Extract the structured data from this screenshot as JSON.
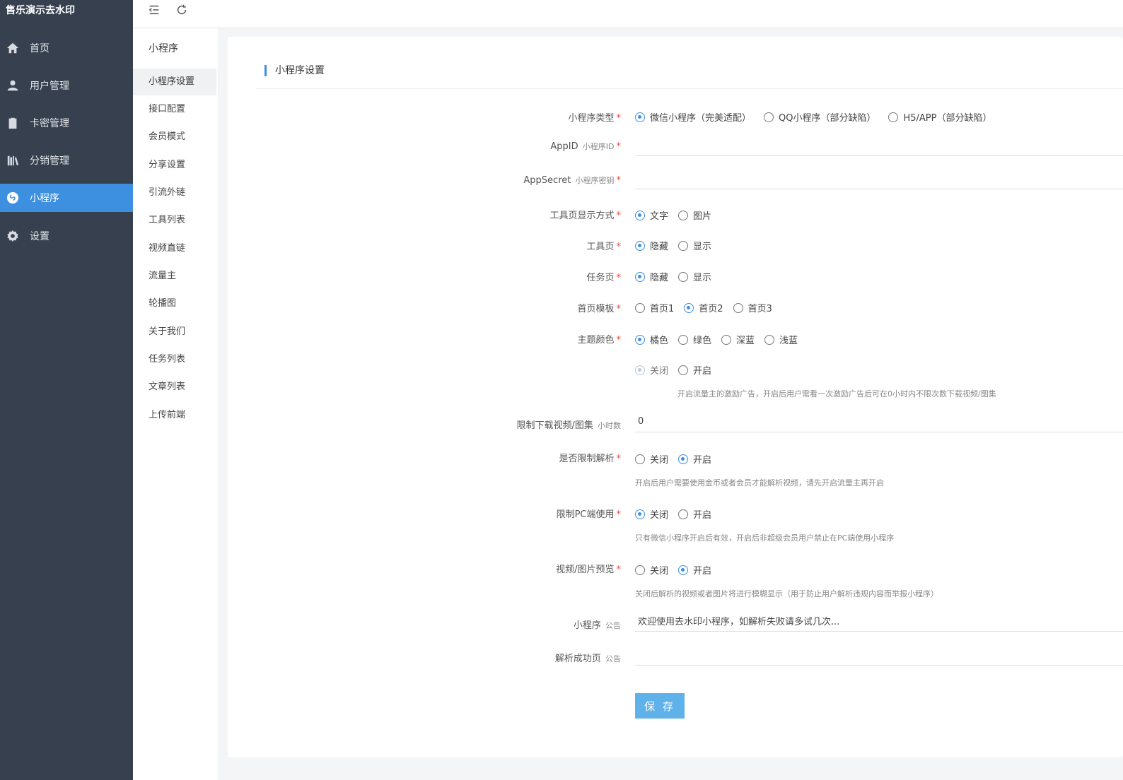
{
  "app": {
    "brand": "售乐演示去水印"
  },
  "sidebar": {
    "items": [
      {
        "label": "首页",
        "icon": "home-icon"
      },
      {
        "label": "用户管理",
        "icon": "user-icon"
      },
      {
        "label": "卡密管理",
        "icon": "clipboard-icon"
      },
      {
        "label": "分销管理",
        "icon": "books-icon"
      },
      {
        "label": "小程序",
        "icon": "mini-program-icon",
        "active": true
      },
      {
        "label": "设置",
        "icon": "gear-icon"
      }
    ]
  },
  "topbar": {
    "menu_toggle_icon": "menu-fold-icon",
    "refresh_icon": "refresh-icon"
  },
  "submenu": {
    "title": "小程序",
    "items": [
      {
        "label": "小程序设置",
        "active": true
      },
      {
        "label": "接口配置"
      },
      {
        "label": "会员模式"
      },
      {
        "label": "分享设置"
      },
      {
        "label": "引流外链"
      },
      {
        "label": "工具列表"
      },
      {
        "label": "视频直链"
      },
      {
        "label": "流量主"
      },
      {
        "label": "轮播图"
      },
      {
        "label": "关于我们"
      },
      {
        "label": "任务列表"
      },
      {
        "label": "文章列表"
      },
      {
        "label": "上传前端"
      }
    ]
  },
  "form": {
    "title": "小程序设置",
    "accent_color": "#3d8fe0",
    "miniapp_type": {
      "label": "小程序类型",
      "options": [
        "微信小程序（完美适配）",
        "QQ小程序（部分缺陷）",
        "H5/APP（部分缺陷）"
      ],
      "selected": 0
    },
    "appid": {
      "label": "AppID",
      "sublabel": "小程序ID",
      "value": ""
    },
    "appsecret": {
      "label": "AppSecret",
      "sublabel": "小程序密钥",
      "value": ""
    },
    "tool_display": {
      "label": "工具页显示方式",
      "options": [
        "文字",
        "图片"
      ],
      "selected": 0
    },
    "tool_page": {
      "label": "工具页",
      "options": [
        "隐藏",
        "显示"
      ],
      "selected": 0
    },
    "task_page": {
      "label": "任务页",
      "options": [
        "隐藏",
        "显示"
      ],
      "selected": 0
    },
    "home_template": {
      "label": "首页模板",
      "options": [
        "首页1",
        "首页2",
        "首页3"
      ],
      "selected": 1
    },
    "theme_color": {
      "label": "主题颜色",
      "options": [
        "橘色",
        "绿色",
        "深蓝",
        "浅蓝"
      ],
      "selected": 0
    },
    "ad_toggle": {
      "options": [
        "关闭",
        "开启"
      ],
      "selected": 0,
      "hint": "开启流量主的激励广告，开启后用户需看一次激励广告后可在0小时内不限次数下载视频/图集"
    },
    "download_limit": {
      "label": "限制下载视频/图集",
      "sublabel": "小时数",
      "value": "0"
    },
    "parse_limit": {
      "label": "是否限制解析",
      "options": [
        "关闭",
        "开启"
      ],
      "selected": 1,
      "hint": "开启后用户需要使用金币或者会员才能解析视频，请先开启流量主再开启"
    },
    "pc_limit": {
      "label": "限制PC端使用",
      "options": [
        "关闭",
        "开启"
      ],
      "selected": 0,
      "hint": "只有微信小程序开启后有效，开启后非超级会员用户禁止在PC端使用小程序"
    },
    "preview": {
      "label": "视频/图片预览",
      "options": [
        "关闭",
        "开启"
      ],
      "selected": 1,
      "hint": "关闭后解析的视频或者图片将进行模糊显示（用于防止用户解析违规内容而举报小程序）"
    },
    "notice": {
      "label": "小程序",
      "sublabel": "公告",
      "value": "欢迎使用去水印小程序，如解析失败请多试几次..."
    },
    "success_notice": {
      "label": "解析成功页",
      "sublabel": "公告",
      "value": ""
    },
    "save_label": "保 存"
  }
}
